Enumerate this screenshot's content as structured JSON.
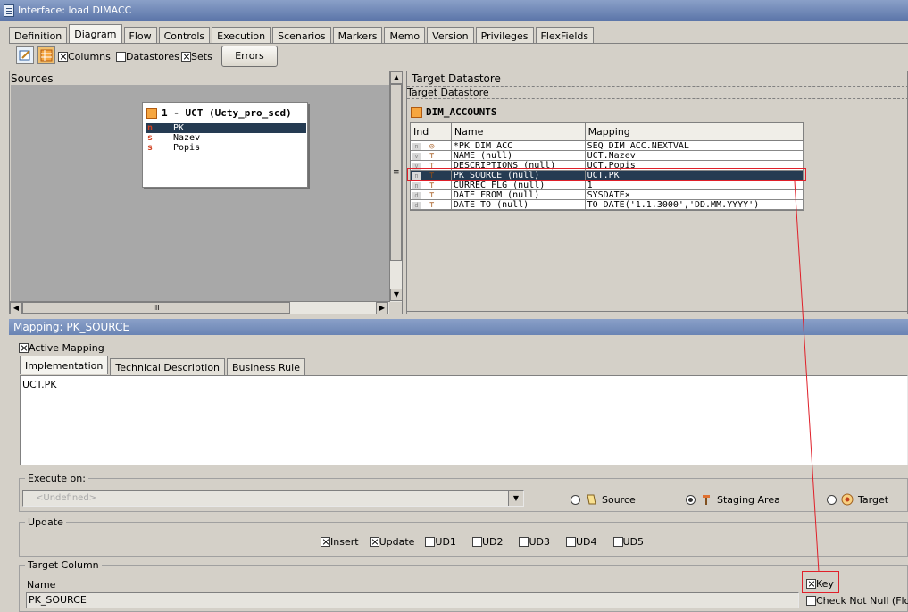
{
  "window": {
    "title": "Interface: load DIMACC"
  },
  "tabs": [
    "Definition",
    "Diagram",
    "Flow",
    "Controls",
    "Execution",
    "Scenarios",
    "Markers",
    "Memo",
    "Version",
    "Privileges",
    "FlexFields"
  ],
  "active_tab": "Diagram",
  "toolbar": {
    "columns_label": "Columns",
    "columns_checked": true,
    "datastores_label": "Datastores",
    "datastores_checked": false,
    "sets_label": "Sets",
    "sets_checked": true,
    "errors_label": "Errors"
  },
  "sources": {
    "title": "Sources",
    "datastore": {
      "title": "1 - UCT (Ucty_pro_scd)",
      "columns": [
        {
          "badge": "n",
          "name": "PK",
          "selected": true
        },
        {
          "badge": "s",
          "name": "Nazev",
          "selected": false
        },
        {
          "badge": "s",
          "name": "Popis",
          "selected": false
        }
      ]
    },
    "hscroll_grip": "III"
  },
  "target": {
    "title": "Target Datastore",
    "subtitle": "Target Datastore",
    "datastore_name": "DIM_ACCOUNTS",
    "headers": {
      "ind": "Ind",
      "name": "Name",
      "mapping": "Mapping"
    },
    "rows": [
      {
        "ind": "n",
        "name": "*PK_DIM_ACC",
        "mapping": "SEQ_DIM_ACC.NEXTVAL",
        "selected": false
      },
      {
        "ind": "v",
        "name": " NAME (null)",
        "mapping": "UCT.Nazev",
        "selected": false
      },
      {
        "ind": "v",
        "name": " DESCRIPTIONS (null)",
        "mapping": "UCT.Popis",
        "selected": false
      },
      {
        "ind": "n",
        "name": " PK_SOURCE (null)",
        "mapping": "UCT.PK",
        "selected": true
      },
      {
        "ind": "n",
        "name": " CURREC_FLG (null)",
        "mapping": "1",
        "selected": false
      },
      {
        "ind": "d",
        "name": " DATE_FROM (null)",
        "mapping": "SYSDATE×",
        "selected": false
      },
      {
        "ind": "d",
        "name": " DATE_TO (null)",
        "mapping": "TO_DATE('1.1.3000','DD.MM.YYYY')",
        "selected": false
      }
    ]
  },
  "mapping": {
    "title": "Mapping: PK_SOURCE",
    "active_label": "Active Mapping",
    "active_checked": true,
    "subtabs": [
      "Implementation",
      "Technical Description",
      "Business Rule"
    ],
    "active_subtab": "Implementation",
    "expression": "UCT.PK",
    "execute_on": {
      "label": "Execute on:",
      "select_value": "<Undefined>",
      "source_label": "Source",
      "staging_label": "Staging Area",
      "target_label": "Target",
      "selected": "staging"
    },
    "update": {
      "label": "Update",
      "options": [
        {
          "label": "Insert",
          "checked": true
        },
        {
          "label": "Update",
          "checked": true
        },
        {
          "label": "UD1",
          "checked": false
        },
        {
          "label": "UD2",
          "checked": false
        },
        {
          "label": "UD3",
          "checked": false
        },
        {
          "label": "UD4",
          "checked": false
        },
        {
          "label": "UD5",
          "checked": false
        }
      ]
    },
    "target_column": {
      "label": "Target Column",
      "name_label": "Name",
      "name_value": "PK_SOURCE",
      "key_label": "Key",
      "key_checked": true,
      "check_not_null_label": "Check Not Null (Flow",
      "check_not_null_checked": false
    }
  },
  "colors": {
    "selection": "#253b52",
    "highlight_box": "#e0202a",
    "panel_bg": "#a8a8a8"
  }
}
